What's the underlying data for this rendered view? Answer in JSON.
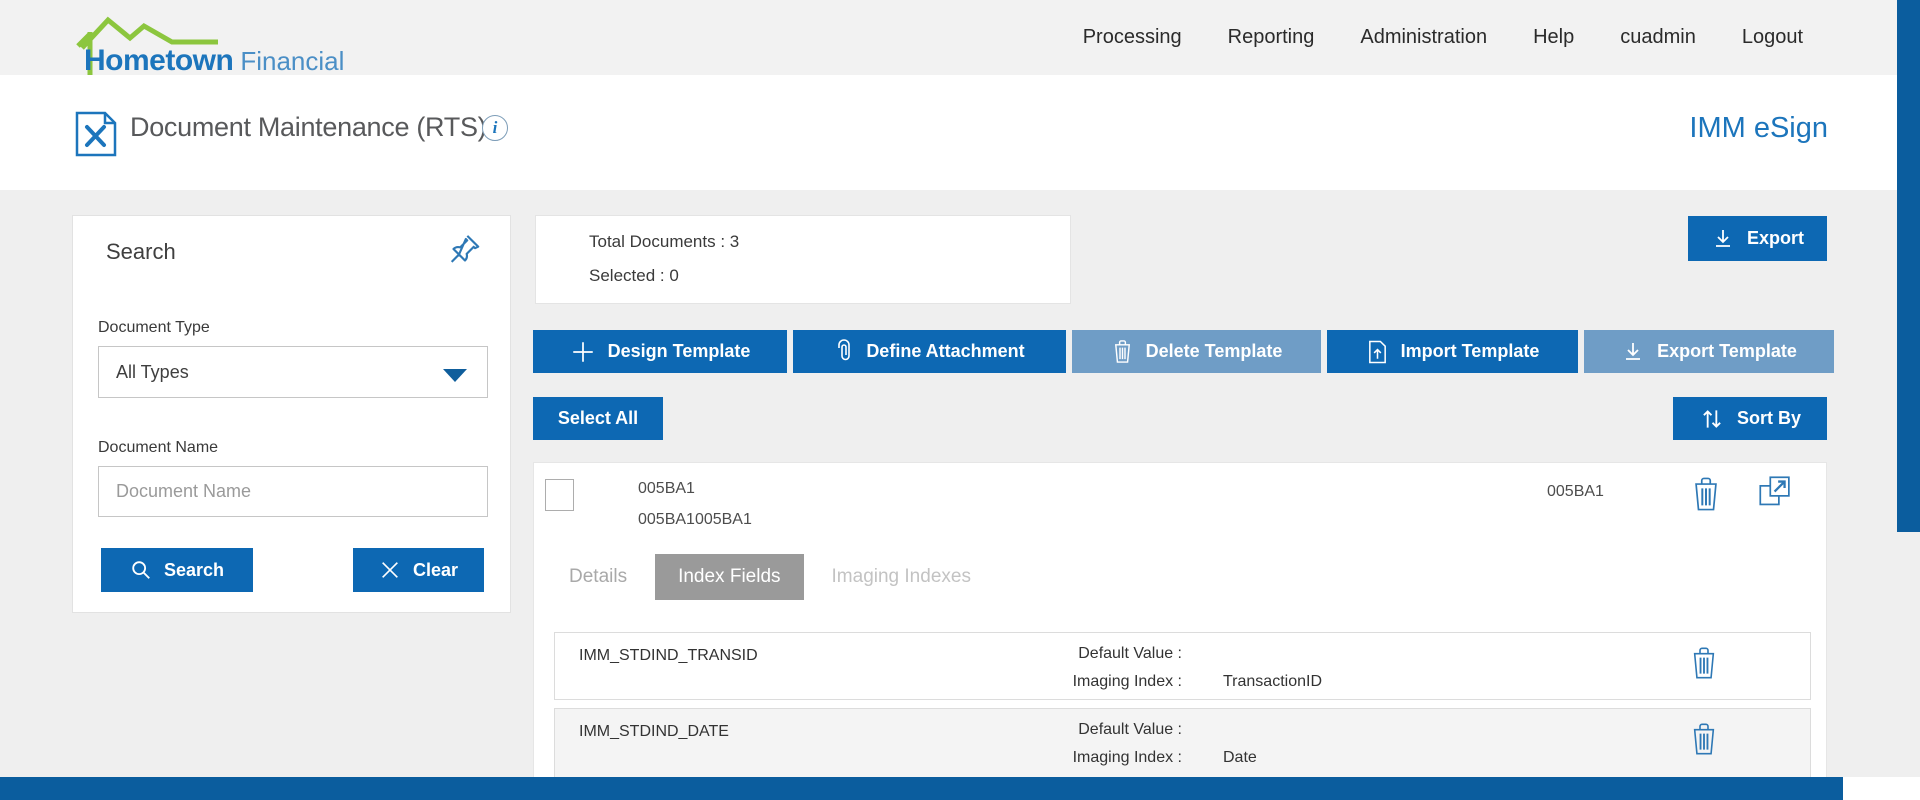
{
  "brand": {
    "name_bold": "Hometown",
    "name_light": "Financial"
  },
  "nav": {
    "items": [
      "Processing",
      "Reporting",
      "Administration",
      "Help",
      "cuadmin",
      "Logout"
    ]
  },
  "header": {
    "title": "Document Maintenance (RTS)",
    "info_glyph": "i",
    "product": "IMM eSign"
  },
  "search_panel": {
    "title": "Search",
    "document_type_label": "Document Type",
    "document_type_value": "All Types",
    "document_name_label": "Document Name",
    "document_name_placeholder": "Document Name",
    "search_button": "Search",
    "clear_button": "Clear"
  },
  "summary": {
    "total_label": "Total Documents : ",
    "total_value": "3",
    "selected_label": "Selected : ",
    "selected_value": "0"
  },
  "toolbar": {
    "export_label": "Export",
    "buttons": [
      {
        "label": "Design Template",
        "icon": "plus-icon",
        "disabled": false
      },
      {
        "label": "Define Attachment",
        "icon": "paperclip-icon",
        "disabled": false
      },
      {
        "label": "Delete Template",
        "icon": "trash-icon",
        "disabled": true
      },
      {
        "label": "Import Template",
        "icon": "import-document-icon",
        "disabled": false
      },
      {
        "label": "Export Template",
        "icon": "download-icon",
        "disabled": true
      }
    ],
    "select_all_label": "Select All",
    "sort_by_label": "Sort By"
  },
  "document": {
    "name": "005BA1",
    "subname": "005BA1005BA1",
    "code": "005BA1",
    "tabs": [
      {
        "label": "Details",
        "active": false
      },
      {
        "label": "Index Fields",
        "active": true
      },
      {
        "label": "Imaging Indexes",
        "active": false
      }
    ],
    "index_fields": [
      {
        "name": "IMM_STDIND_TRANSID",
        "default_value_label": "Default Value :",
        "default_value": "",
        "imaging_index_label": "Imaging Index :",
        "imaging_index": "TransactionID"
      },
      {
        "name": "IMM_STDIND_DATE",
        "default_value_label": "Default Value :",
        "default_value": "",
        "imaging_index_label": "Imaging Index :",
        "imaging_index": "Date"
      }
    ]
  },
  "icons": {
    "logo": "house-roof-icon",
    "page": "document-tools-icon",
    "info": "info-circle-icon",
    "pin": "pushpin-icon",
    "search": "magnifier-icon",
    "clear": "x-icon",
    "export": "download-icon",
    "sort": "up-down-arrows-icon",
    "delete": "trash-icon",
    "open": "open-in-new-icon"
  },
  "colors": {
    "primary_button": "#0d68b3",
    "disabled_button": "#6f9dc6",
    "brand_blue": "#1c75bc",
    "brand_green": "#8cc63e",
    "footer_blue": "#0b5d9e",
    "active_tab": "#9a9a9a",
    "topbar_bg": "#f2f2f2",
    "body_bg": "#efefef"
  }
}
